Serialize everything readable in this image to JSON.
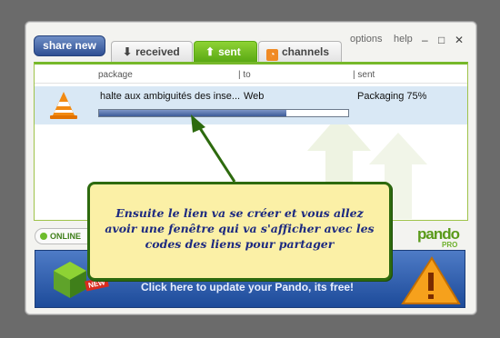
{
  "toolbar": {
    "share_label": "share new",
    "options_label": "options",
    "help_label": "help"
  },
  "tabs": [
    {
      "label": "received",
      "icon": "down-arrow-icon"
    },
    {
      "label": "sent",
      "icon": "up-arrow-icon"
    },
    {
      "label": "channels",
      "icon": "rss-icon"
    }
  ],
  "columns": {
    "package": "package",
    "to": "| to",
    "sent": "| sent"
  },
  "transfer": {
    "name": "halte aux ambiguités des inse...",
    "to": "Web",
    "status": "Packaging 75%",
    "progress_fraction": 0.75,
    "icon": "vlc-cone-icon"
  },
  "status": {
    "label": "ONLINE"
  },
  "brand": {
    "name": "pando",
    "tier": "PRO",
    "accent": "#76b82a"
  },
  "banner": {
    "badge": "NEW",
    "text": "Click here to update your Pando, its free!"
  },
  "annotation": {
    "text": "Ensuite le lien va se créer et vous allez avoir une fenêtre qui va s'afficher avec les codes des liens pour partager"
  }
}
